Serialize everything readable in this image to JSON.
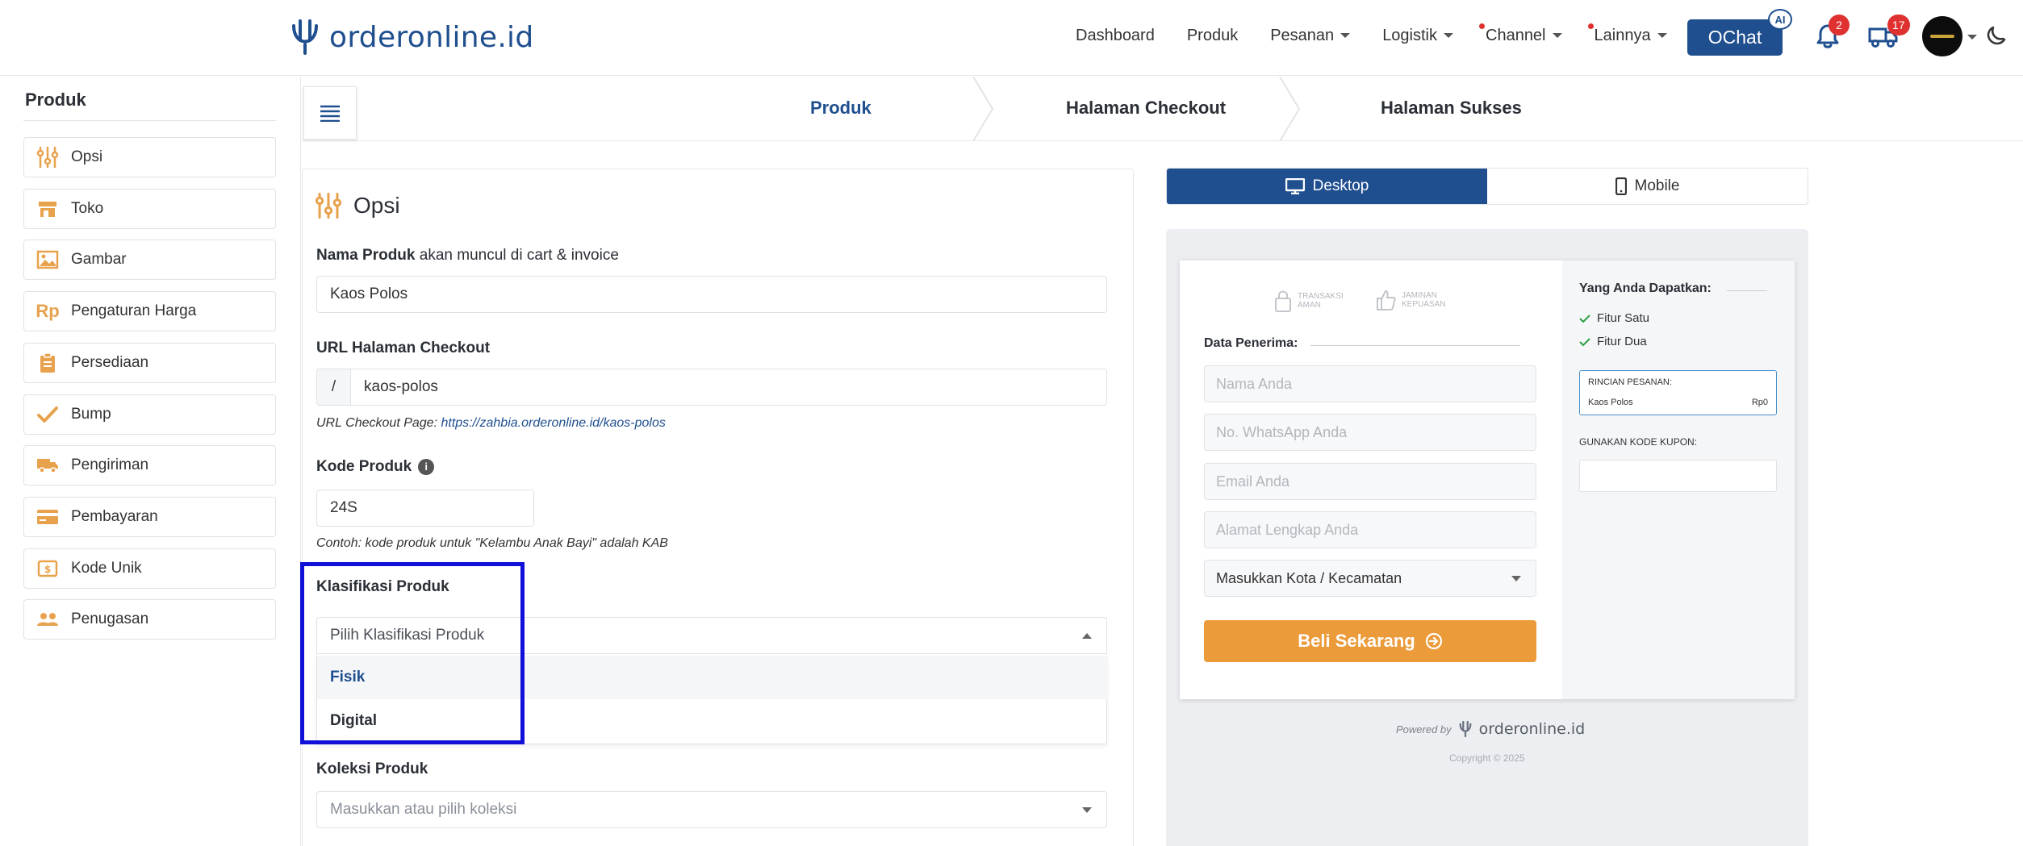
{
  "brand": {
    "name": "orderonline.id"
  },
  "nav": {
    "items": [
      {
        "label": "Dashboard",
        "dropdown": false,
        "dot": false
      },
      {
        "label": "Produk",
        "dropdown": false,
        "dot": false
      },
      {
        "label": "Pesanan",
        "dropdown": true,
        "dot": false
      },
      {
        "label": "Logistik",
        "dropdown": true,
        "dot": false
      },
      {
        "label": "Channel",
        "dropdown": true,
        "dot": true
      },
      {
        "label": "Lainnya",
        "dropdown": true,
        "dot": true
      }
    ],
    "ochat_label": "OChat",
    "ai_badge": "AI",
    "notifications_count": "2",
    "shipping_count": "17"
  },
  "sidebar": {
    "title": "Produk",
    "items": [
      {
        "label": "Opsi",
        "icon": "sliders-icon"
      },
      {
        "label": "Toko",
        "icon": "store-icon"
      },
      {
        "label": "Gambar",
        "icon": "image-icon"
      },
      {
        "label": "Pengaturan Harga",
        "icon": "rupiah-icon"
      },
      {
        "label": "Persediaan",
        "icon": "clipboard-icon"
      },
      {
        "label": "Bump",
        "icon": "check-icon"
      },
      {
        "label": "Pengiriman",
        "icon": "truck-icon"
      },
      {
        "label": "Pembayaran",
        "icon": "credit-card-icon"
      },
      {
        "label": "Kode Unik",
        "icon": "money-icon"
      },
      {
        "label": "Penugasan",
        "icon": "users-icon"
      }
    ]
  },
  "stepper": {
    "steps": [
      "Produk",
      "Halaman Checkout",
      "Halaman Sukses"
    ],
    "active": "Produk"
  },
  "form": {
    "section_title": "Opsi",
    "product_name": {
      "label_bold": "Nama Produk",
      "label_rest": "akan muncul di cart & invoice",
      "value": "Kaos Polos"
    },
    "checkout_url": {
      "label": "URL Halaman Checkout",
      "prefix": "/",
      "value": "kaos-polos",
      "hint_prefix": "URL Checkout Page:",
      "hint_link": "https://zahbia.orderonline.id/kaos-polos"
    },
    "product_code": {
      "label": "Kode Produk",
      "info": "i",
      "value": "24S",
      "hint": "Contoh: kode produk untuk \"Kelambu Anak Bayi\" adalah KAB"
    },
    "classification": {
      "label": "Klasifikasi Produk",
      "placeholder": "Pilih Klasifikasi Produk",
      "options": [
        "Fisik",
        "Digital"
      ],
      "highlighted": "Fisik"
    },
    "collection": {
      "label": "Koleksi Produk",
      "placeholder": "Masukkan atau pilih koleksi"
    }
  },
  "preview": {
    "tabs": [
      {
        "label": "Desktop",
        "active": true
      },
      {
        "label": "Mobile",
        "active": false
      }
    ],
    "trust_badges": [
      {
        "line1": "TRANSAKSI",
        "line2": "AMAN"
      },
      {
        "line1": "JAMINAN",
        "line2": "KEPUASAN"
      }
    ],
    "receiver_title": "Data Penerima:",
    "fields": [
      "Nama Anda",
      "No. WhatsApp Anda",
      "Email Anda",
      "Alamat Lengkap Anda"
    ],
    "city_select": "Masukkan Kota / Kecamatan",
    "buy_button": "Beli Sekarang",
    "benefits_title": "Yang Anda Dapatkan:",
    "features": [
      "Fitur Satu",
      "Fitur Dua"
    ],
    "order_details_title": "RINCIAN PESANAN:",
    "order_item": "Kaos Polos",
    "order_price": "Rp0",
    "coupon_label": "GUNAKAN KODE KUPON:",
    "powered_by": "Powered by",
    "powered_brand": "orderonline.id",
    "copyright": "Copyright © 2025"
  },
  "colors": {
    "brand": "#1f4f8f",
    "accent_orange": "#ec9b3b",
    "badge_red": "#e03131",
    "highlight_box": "#1010d8"
  }
}
